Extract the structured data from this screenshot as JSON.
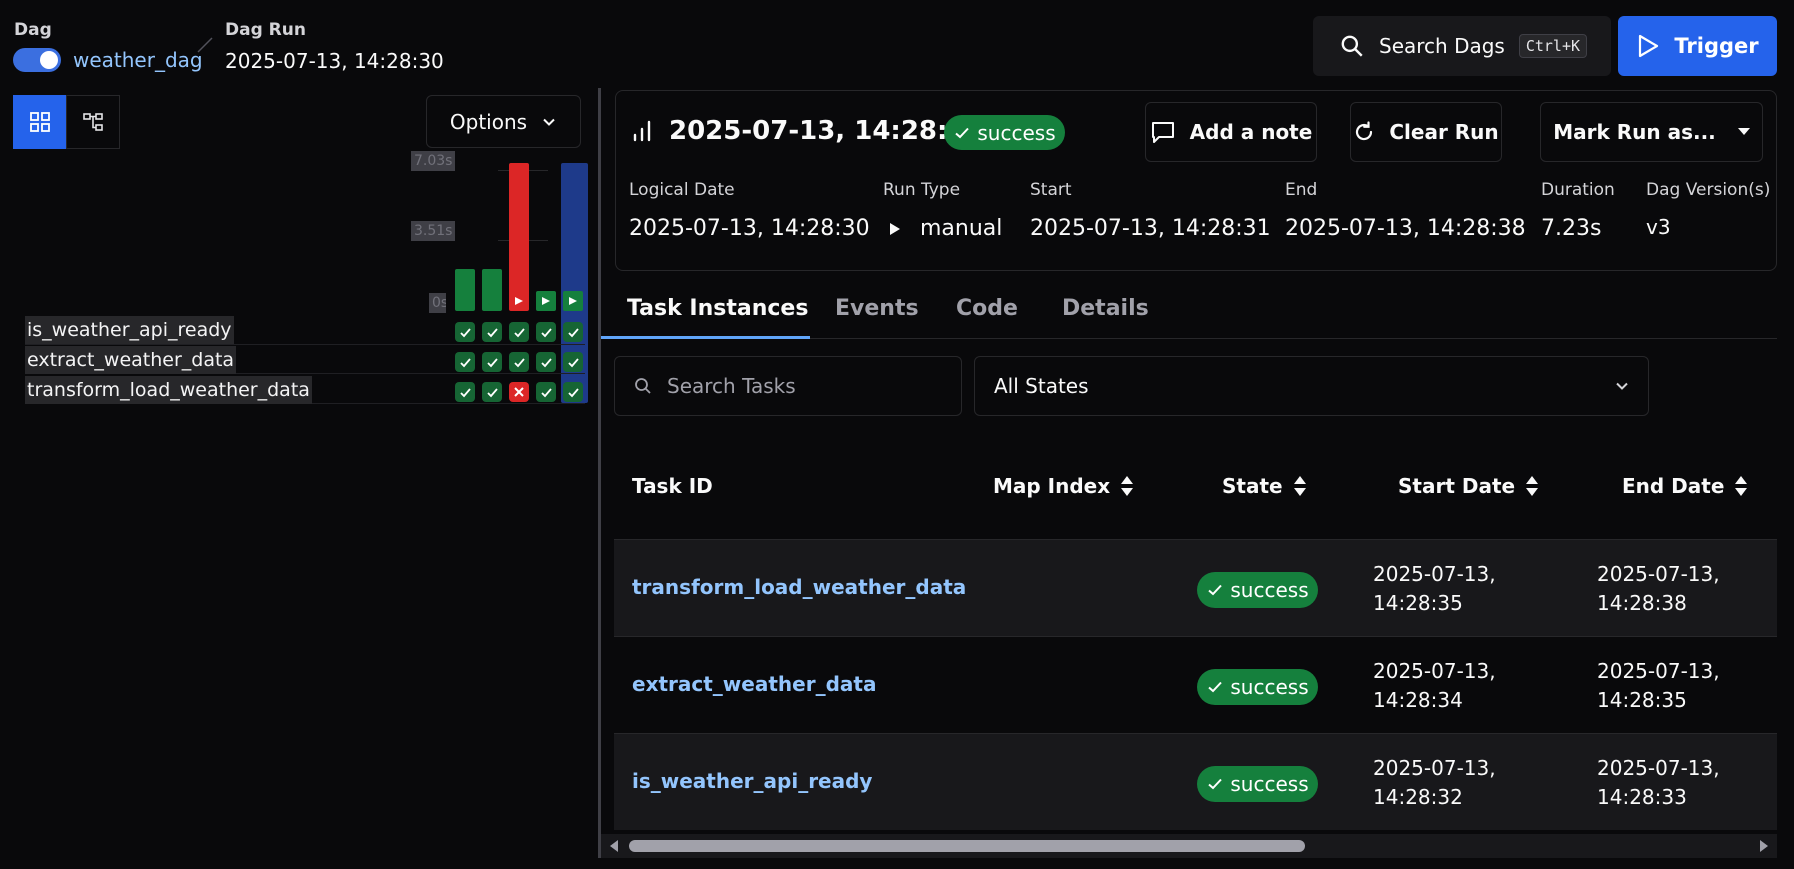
{
  "header": {
    "dag_label": "Dag",
    "dag_name": "weather_dag",
    "dagrun_label": "Dag Run",
    "dagrun_value": "2025-07-13, 14:28:30",
    "search_label": "Search Dags",
    "search_shortcut": "Ctrl+K",
    "trigger_label": "Trigger",
    "dag_paused": false
  },
  "grid": {
    "options_label": "Options",
    "duration_ticks": [
      "7.03s",
      "3.51s",
      "0s"
    ],
    "tasks": [
      "is_weather_api_ready",
      "extract_weather_data",
      "transform_load_weather_data"
    ],
    "runs": [
      {
        "duration_s": 2.0,
        "state": "success",
        "cells": [
          "success",
          "success",
          "success"
        ]
      },
      {
        "duration_s": 2.0,
        "state": "success",
        "cells": [
          "success",
          "success",
          "success"
        ]
      },
      {
        "duration_s": 7.03,
        "state": "failed",
        "cells": [
          "success",
          "success",
          "failed"
        ]
      },
      {
        "duration_s": 0.0,
        "state": "success",
        "cells": [
          "success",
          "success",
          "success"
        ]
      },
      {
        "duration_s": 7.23,
        "state": "success",
        "selected": true,
        "cells": [
          "success",
          "success",
          "success"
        ]
      }
    ],
    "colors": {
      "success": "#15803d",
      "failed": "#dc2626",
      "selected": "#1e3a8a"
    }
  },
  "run": {
    "title": "2025-07-13, 14:28:30",
    "state": "success",
    "add_note": "Add a note",
    "clear_run": "Clear Run",
    "mark_run_as": "Mark Run as...",
    "meta": {
      "logical_date_label": "Logical Date",
      "logical_date": "2025-07-13, 14:28:30",
      "run_type_label": "Run Type",
      "run_type": "manual",
      "start_label": "Start",
      "start": "2025-07-13, 14:28:31",
      "end_label": "End",
      "end": "2025-07-13, 14:28:38",
      "duration_label": "Duration",
      "duration": "7.23s",
      "version_label": "Dag Version(s)",
      "version": "v3"
    }
  },
  "tabs": [
    "Task Instances",
    "Events",
    "Code",
    "Details"
  ],
  "filters": {
    "search_placeholder": "Search Tasks",
    "state_select": "All States"
  },
  "table": {
    "columns": [
      "Task ID",
      "Map Index",
      "State",
      "Start Date",
      "End Date"
    ],
    "rows": [
      {
        "task_id": "transform_load_weather_data",
        "state": "success",
        "start_date": "2025-07-13,",
        "start_time": "14:28:35",
        "end_date": "2025-07-13,",
        "end_time": "14:28:38"
      },
      {
        "task_id": "extract_weather_data",
        "state": "success",
        "start_date": "2025-07-13,",
        "start_time": "14:28:34",
        "end_date": "2025-07-13,",
        "end_time": "14:28:35"
      },
      {
        "task_id": "is_weather_api_ready",
        "state": "success",
        "start_date": "2025-07-13,",
        "start_time": "14:28:32",
        "end_date": "2025-07-13,",
        "end_time": "14:28:33"
      }
    ]
  }
}
